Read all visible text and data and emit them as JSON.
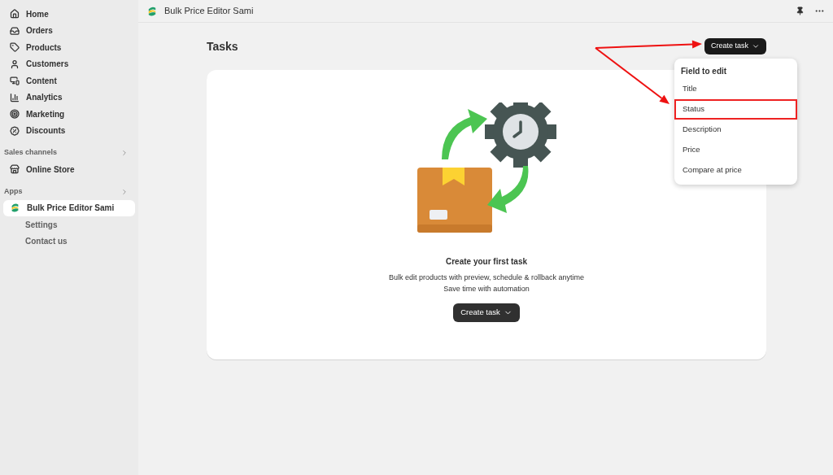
{
  "sidebar": {
    "items": [
      {
        "label": "Home",
        "selected": false
      },
      {
        "label": "Orders",
        "selected": false
      },
      {
        "label": "Products",
        "selected": false
      },
      {
        "label": "Customers",
        "selected": false
      },
      {
        "label": "Content",
        "selected": false
      },
      {
        "label": "Analytics",
        "selected": false
      },
      {
        "label": "Marketing",
        "selected": false
      },
      {
        "label": "Discounts",
        "selected": false
      }
    ],
    "sections": [
      {
        "title": "Sales channels",
        "items": [
          {
            "label": "Online Store",
            "selected": false
          }
        ]
      },
      {
        "title": "Apps",
        "items": [
          {
            "label": "Bulk Price Editor Sami",
            "selected": true,
            "children": [
              {
                "label": "Settings"
              },
              {
                "label": "Contact us"
              }
            ]
          }
        ]
      }
    ]
  },
  "top_bar": {
    "title": "Bulk Price Editor Sami"
  },
  "page": {
    "title": "Tasks",
    "header_button": "Create task"
  },
  "dropdown": {
    "heading": "Field to edit",
    "items": [
      {
        "label": "Title",
        "highlighted": false
      },
      {
        "label": "Status",
        "highlighted": true
      },
      {
        "label": "Description",
        "highlighted": false
      },
      {
        "label": "Price",
        "highlighted": false
      },
      {
        "label": "Compare at price",
        "highlighted": false
      }
    ]
  },
  "empty_state": {
    "heading": "Create your first task",
    "lines": [
      "Bulk edit products with preview, schedule & rollback anytime",
      "Save time with automation"
    ],
    "button": "Create task"
  }
}
